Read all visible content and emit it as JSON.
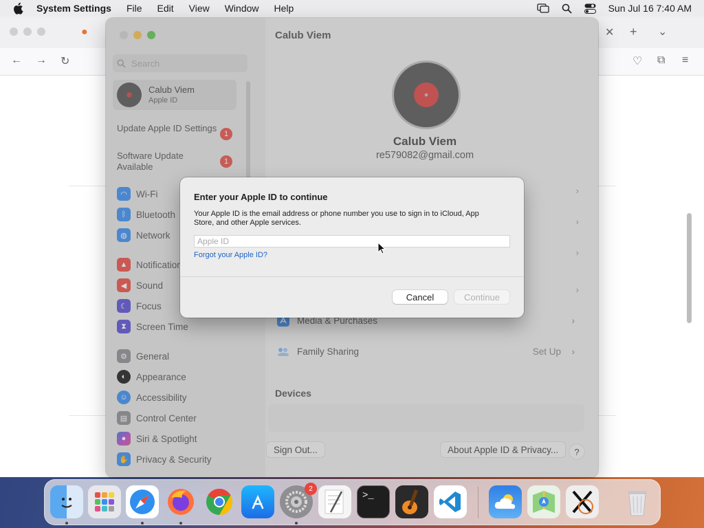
{
  "menubar": {
    "app_name": "System Settings",
    "menus": [
      "File",
      "Edit",
      "View",
      "Window",
      "Help"
    ],
    "clock": "Sun Jul 16  7:40 AM"
  },
  "window": {
    "title": "Calub Viem",
    "search_placeholder": "Search",
    "account": {
      "name": "Calub Viem",
      "subtitle": "Apple ID"
    },
    "notices": [
      {
        "label": "Update Apple ID Settings",
        "badge": "1"
      },
      {
        "label": "Software Update Available",
        "badge": "1"
      }
    ],
    "sidebar_items": [
      {
        "label": "Wi-Fi",
        "icon": "wifi-icon",
        "color": "#3b8ef0"
      },
      {
        "label": "Bluetooth",
        "icon": "bluetooth-icon",
        "color": "#3b8ef0"
      },
      {
        "label": "Network",
        "icon": "globe-icon",
        "color": "#3b8ef0"
      },
      {
        "label": "Notifications",
        "icon": "bell-icon",
        "color": "#ea4d46"
      },
      {
        "label": "Sound",
        "icon": "speaker-icon",
        "color": "#ea4d46"
      },
      {
        "label": "Focus",
        "icon": "moon-icon",
        "color": "#5b4fd4"
      },
      {
        "label": "Screen Time",
        "icon": "hourglass-icon",
        "color": "#5b4fd4"
      },
      {
        "label": "General",
        "icon": "gear-icon",
        "color": "#8e8e93"
      },
      {
        "label": "Appearance",
        "icon": "appearance-icon",
        "color": "#1c1c1e"
      },
      {
        "label": "Accessibility",
        "icon": "accessibility-icon",
        "color": "#3b8ef0"
      },
      {
        "label": "Control Center",
        "icon": "control-center-icon",
        "color": "#8e8e93"
      },
      {
        "label": "Siri & Spotlight",
        "icon": "siri-icon",
        "color": "#b24fd0"
      },
      {
        "label": "Privacy & Security",
        "icon": "hand-icon",
        "color": "#3b8ef0"
      }
    ],
    "profile": {
      "name": "Calub Viem",
      "email": "re579082@gmail.com"
    },
    "rows": [
      {
        "label": "Media & Purchases",
        "right": ""
      },
      {
        "label": "Family Sharing",
        "right": "Set Up"
      }
    ],
    "devices_heading": "Devices",
    "sign_out": "Sign Out...",
    "about": "About Apple ID & Privacy...",
    "help": "?"
  },
  "dialog": {
    "title": "Enter your Apple ID to continue",
    "description": "Your Apple ID is the email address or phone number you use to sign in to iCloud, App Store, and other Apple services.",
    "input_placeholder": "Apple ID",
    "input_value": "",
    "forgot_link": "Forgot your Apple ID?",
    "cancel": "Cancel",
    "continue": "Continue"
  },
  "dock": {
    "apps": [
      "Finder",
      "Launchpad",
      "Safari",
      "Firefox",
      "Chrome",
      "App Store",
      "System Settings",
      "TextEdit",
      "Terminal",
      "GarageBand",
      "VS Code",
      "Weather",
      "Maps",
      "X11",
      "Trash"
    ],
    "system_settings_badge": "2"
  }
}
